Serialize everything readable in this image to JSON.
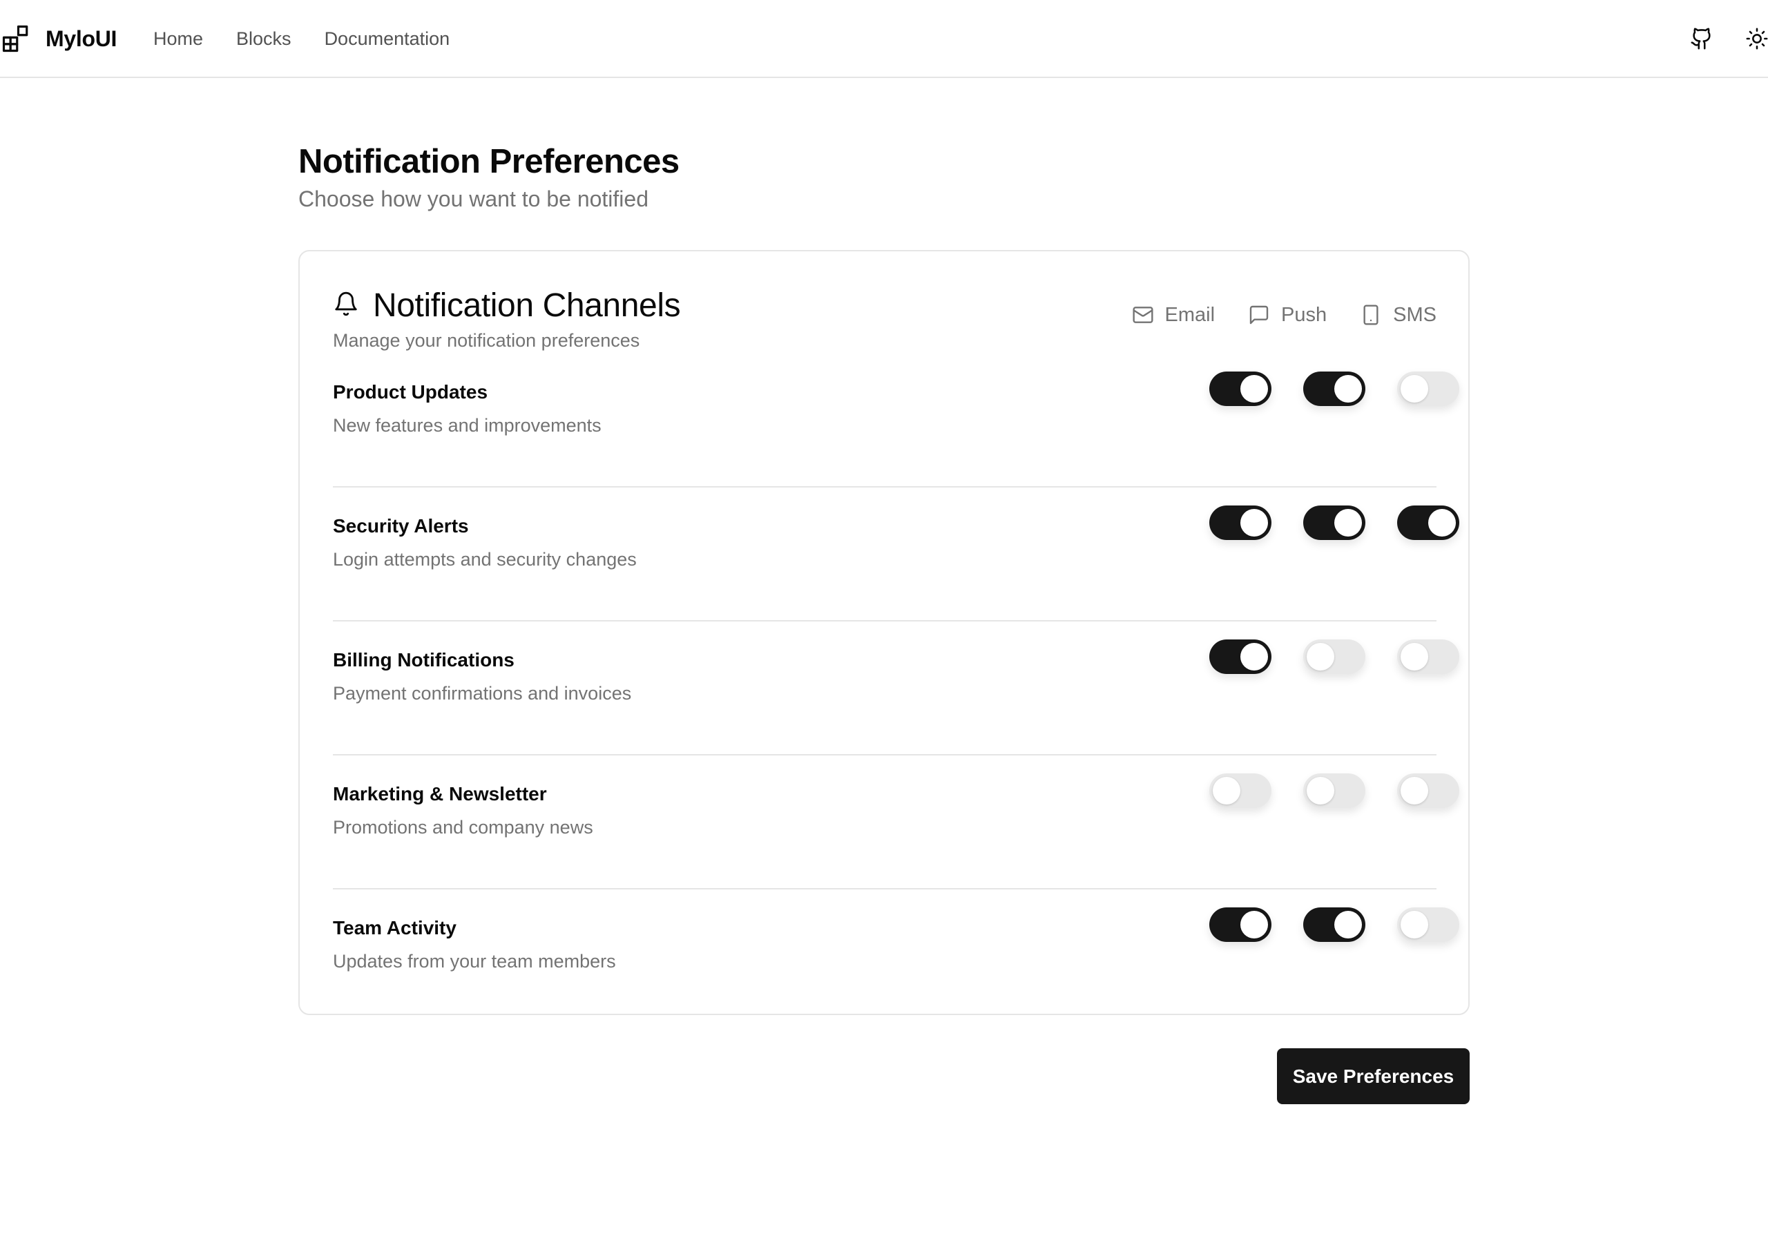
{
  "nav": {
    "brand": "MyloUI",
    "links": [
      "Home",
      "Blocks",
      "Documentation"
    ],
    "icons": {
      "brand": "grid-blocks-icon",
      "github": "github-icon",
      "theme": "sun-icon"
    }
  },
  "page": {
    "title": "Notification Preferences",
    "subtitle": "Choose how you want to be notified"
  },
  "card": {
    "title": "Notification Channels",
    "subtitle": "Manage your notification preferences",
    "icon": "bell-icon",
    "channels": [
      {
        "label": "Email",
        "icon": "mail-icon"
      },
      {
        "label": "Push",
        "icon": "message-square-icon"
      },
      {
        "label": "SMS",
        "icon": "smartphone-icon"
      }
    ]
  },
  "rows": [
    {
      "label": "Product Updates",
      "description": "New features and improvements",
      "toggles": [
        true,
        true,
        false
      ]
    },
    {
      "label": "Security Alerts",
      "description": "Login attempts and security changes",
      "toggles": [
        true,
        true,
        true
      ]
    },
    {
      "label": "Billing Notifications",
      "description": "Payment confirmations and invoices",
      "toggles": [
        true,
        false,
        false
      ]
    },
    {
      "label": "Marketing & Newsletter",
      "description": "Promotions and company news",
      "toggles": [
        false,
        false,
        false
      ]
    },
    {
      "label": "Team Activity",
      "description": "Updates from your team members",
      "toggles": [
        true,
        true,
        false
      ]
    }
  ],
  "actions": {
    "save_label": "Save Preferences"
  },
  "colors": {
    "accent": "#171717",
    "muted_text": "#737373",
    "border": "#e5e5e5",
    "toggle_off": "#e8e8e8"
  }
}
